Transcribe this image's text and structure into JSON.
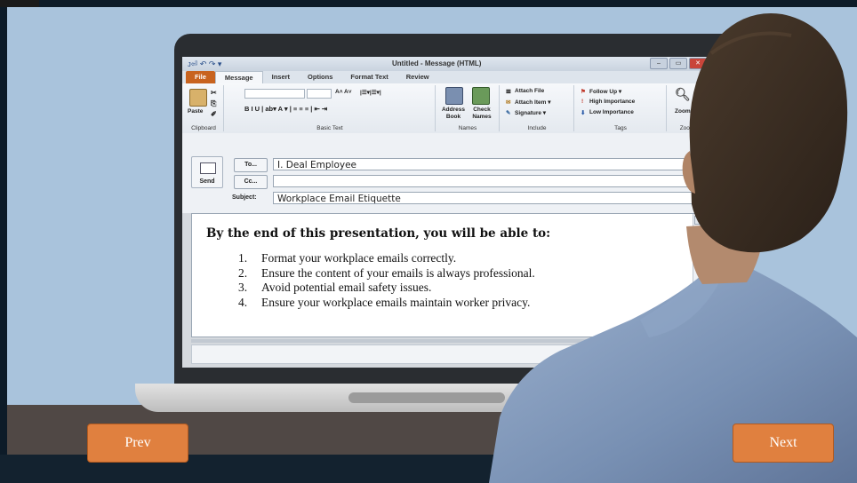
{
  "window": {
    "title": "Untitled - Message (HTML)",
    "qat": "ᴊ⏎ ↶ ↷ ▾"
  },
  "ribbon": {
    "tabs": [
      "File",
      "Message",
      "Insert",
      "Options",
      "Format Text",
      "Review"
    ],
    "groups": {
      "clipboard": {
        "label": "Clipboard",
        "paste": "Paste"
      },
      "basic_text": {
        "label": "Basic Text",
        "format_row": "B  I  U  |  ab▾  A ▾  |  ≡  ≡  ≡  |  ⇤  ⇥"
      },
      "names": {
        "label": "Names",
        "address_book": "Address Book",
        "check_names": "Check Names"
      },
      "include": {
        "label": "Include",
        "attach_file": "Attach File",
        "attach_item": "Attach Item ▾",
        "signature": "Signature ▾"
      },
      "tags": {
        "label": "Tags",
        "follow_up": "Follow Up ▾",
        "high_importance": "High Importance",
        "low_importance": "Low Importance"
      },
      "zoom": {
        "label": "Zoom",
        "zoom": "Zoom"
      }
    }
  },
  "compose": {
    "send_label": "Send",
    "to_button": "To...",
    "cc_button": "Cc...",
    "subject_label": "Subject:",
    "to_value": "I. Deal Employee",
    "cc_value": "",
    "subject_value": "Workplace Email Etiquette"
  },
  "message": {
    "heading": "By the end of this presentation, you will be able to:",
    "items": [
      "Format your workplace emails correctly.",
      "Ensure the content of your emails is always professional.",
      "Avoid potential email safety issues.",
      "Ensure your workplace emails maintain worker privacy."
    ],
    "numbers": [
      "1.",
      "2.",
      "3.",
      "4."
    ]
  },
  "nav": {
    "prev_label": "Prev",
    "next_label": "Next"
  },
  "colors": {
    "wall": "#a9c3dc",
    "nav_button": "#e0803f",
    "file_tab": "#c8631f"
  }
}
